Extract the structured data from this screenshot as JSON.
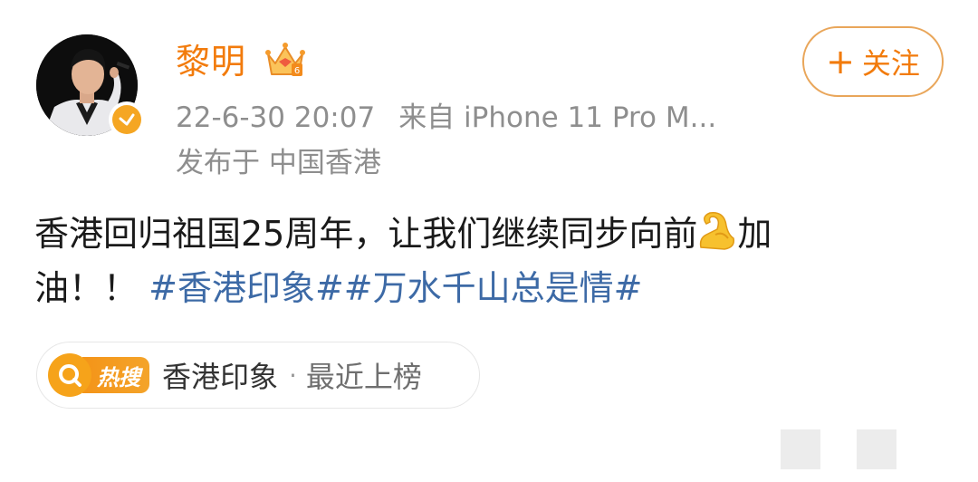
{
  "user": {
    "name": "黎明",
    "verified": true,
    "accent_color": "#f27b0c"
  },
  "post": {
    "timestamp": "22-6-30 20:07",
    "source": "来自 iPhone 11 Pro M...",
    "location": "发布于 中国香港",
    "text_line1": "香港回归祖国25周年，让我们继续同步向前",
    "text_line1_tail": "加",
    "text_line2": "油！！",
    "hashtags": [
      "#香港印象#",
      "#万水千山总是情#"
    ],
    "hashtag_color": "#3d6aa6",
    "emoji": "flexed-biceps-icon"
  },
  "follow_button": {
    "plus": "+",
    "label": "关注"
  },
  "hot_search": {
    "badge_label": "热搜",
    "topic": "香港印象",
    "separator": "·",
    "status": "最近上榜"
  }
}
